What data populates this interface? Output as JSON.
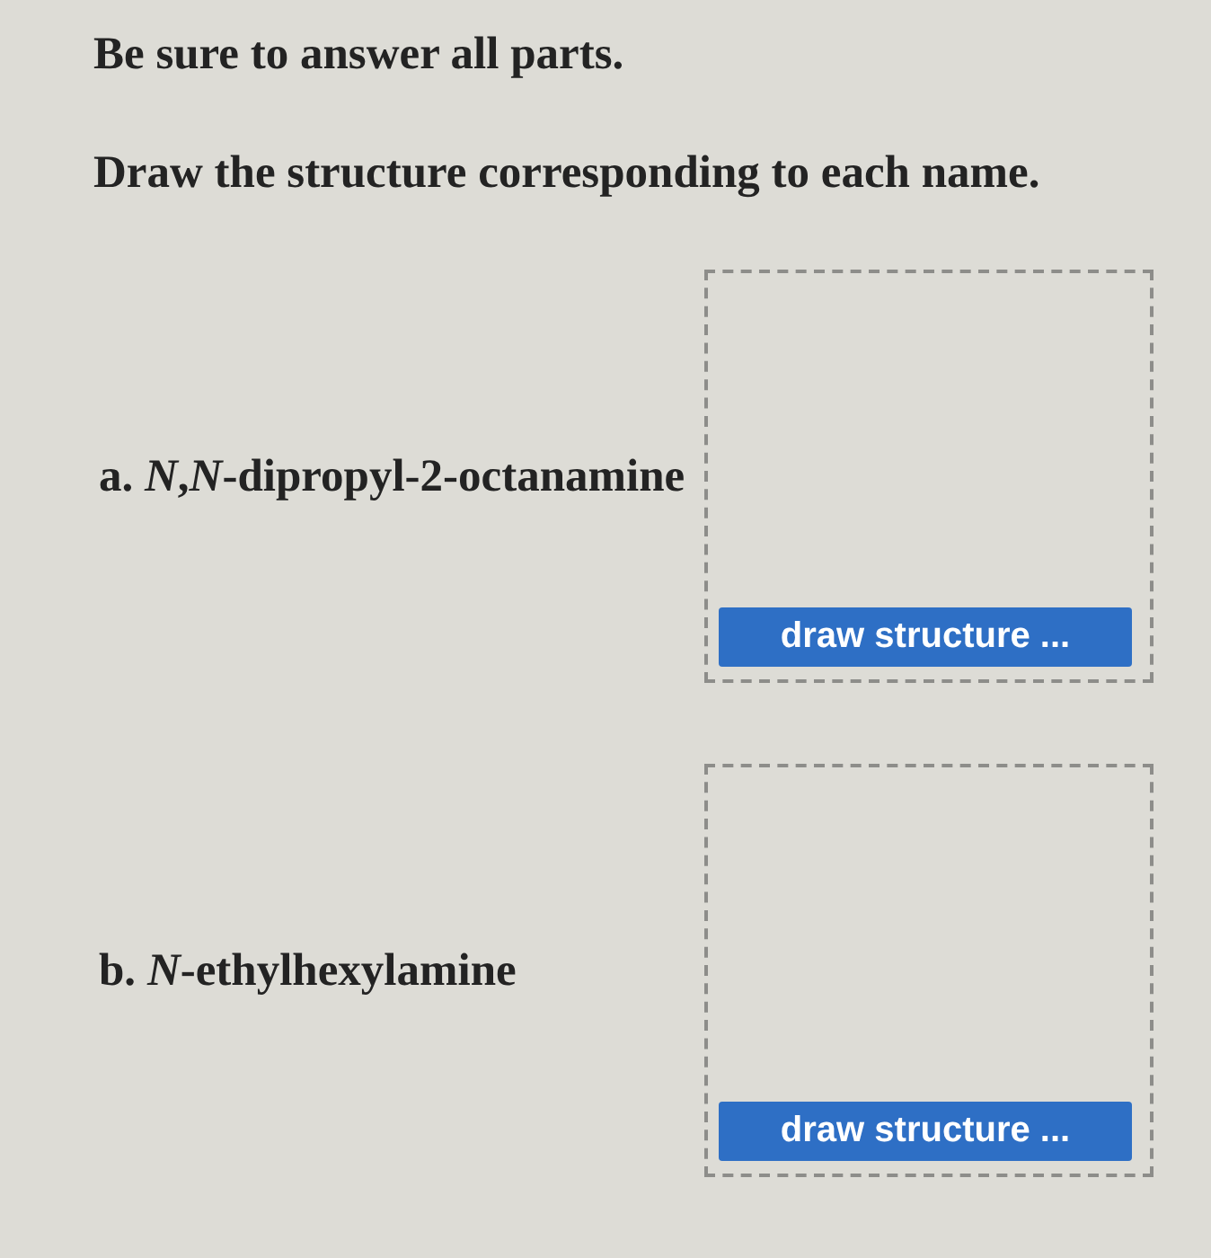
{
  "instructions": [
    "Be sure to answer all parts.",
    "Draw the structure corresponding to each name."
  ],
  "questions": [
    {
      "prompt": "a. *N*,*N*-dipropyl-2-octanamine",
      "button": "draw structure ..."
    },
    {
      "prompt": "b. *N*-ethylhexylamine",
      "button": "draw structure ..."
    }
  ]
}
